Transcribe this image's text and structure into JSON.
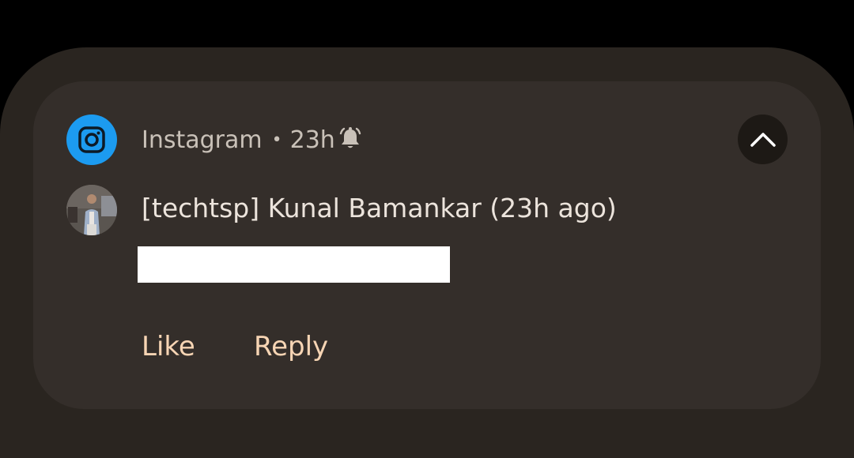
{
  "notification": {
    "app_name": "Instagram",
    "separator": "•",
    "time": "23h",
    "app_icon": "instagram-camera-icon",
    "status_icon": "bell-alert-icon",
    "collapse_icon": "chevron-up-icon",
    "message": {
      "sender_line": "[techtsp] Kunal Bamankar (23h ago)",
      "avatar": "user-photo"
    },
    "actions": {
      "like_label": "Like",
      "reply_label": "Reply"
    }
  },
  "colors": {
    "background": "#000000",
    "panel": "#2a2520",
    "card": "#342e2a",
    "app_icon_bg": "#1c9bf0",
    "action_text": "#f7d5b4",
    "header_text": "#c9c1b8",
    "title_text": "#ece4dc",
    "collapse_button_bg": "#1d1915"
  }
}
